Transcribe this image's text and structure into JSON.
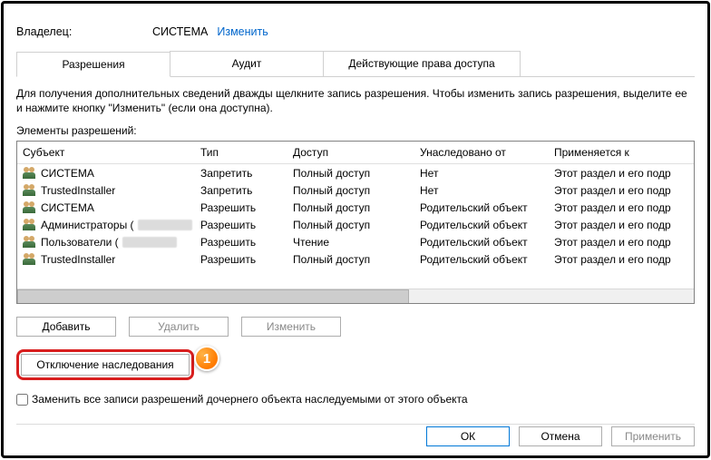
{
  "owner": {
    "label": "Владелец:",
    "value": "СИСТЕМА",
    "change": "Изменить"
  },
  "tabs": [
    {
      "label": "Разрешения",
      "active": true
    },
    {
      "label": "Аудит",
      "active": false
    },
    {
      "label": "Действующие права доступа",
      "active": false
    }
  ],
  "info": "Для получения дополнительных сведений дважды щелкните запись разрешения. Чтобы изменить запись разрешения, выделите ее и нажмите кнопку \"Изменить\" (если она доступна).",
  "elements_label": "Элементы разрешений:",
  "columns": {
    "subject": "Субъект",
    "type": "Тип",
    "access": "Доступ",
    "inherited": "Унаследовано от",
    "applies": "Применяется к"
  },
  "rows": [
    {
      "subject": "СИСТЕМА",
      "type": "Запретить",
      "access": "Полный доступ",
      "inherited": "Нет",
      "applies": "Этот раздел и его подр",
      "blur": false
    },
    {
      "subject": "TrustedInstaller",
      "type": "Запретить",
      "access": "Полный доступ",
      "inherited": "Нет",
      "applies": "Этот раздел и его подр",
      "blur": false
    },
    {
      "subject": "СИСТЕМА",
      "type": "Разрешить",
      "access": "Полный доступ",
      "inherited": "Родительский объект",
      "applies": "Этот раздел и его подр",
      "blur": false
    },
    {
      "subject": "Администраторы (",
      "type": "Разрешить",
      "access": "Полный доступ",
      "inherited": "Родительский объект",
      "applies": "Этот раздел и его подр",
      "blur": true
    },
    {
      "subject": "Пользователи (",
      "type": "Разрешить",
      "access": "Чтение",
      "inherited": "Родительский объект",
      "applies": "Этот раздел и его подр",
      "blur": true
    },
    {
      "subject": "TrustedInstaller",
      "type": "Разрешить",
      "access": "Полный доступ",
      "inherited": "Родительский объект",
      "applies": "Этот раздел и его подр",
      "blur": false
    }
  ],
  "action_buttons": {
    "add": "Добавить",
    "remove": "Удалить",
    "edit": "Изменить"
  },
  "disable_inherit": "Отключение наследования",
  "step_number": "1",
  "replace_checkbox": "Заменить все записи разрешений дочернего объекта наследуемыми от этого объекта",
  "footer": {
    "ok": "ОК",
    "cancel": "Отмена",
    "apply": "Применить"
  }
}
